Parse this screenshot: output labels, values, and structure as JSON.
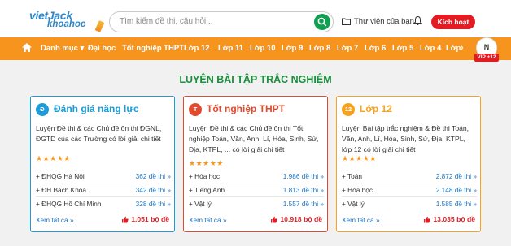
{
  "header": {
    "logo_top": "vietJack",
    "logo_bottom": "khoahoc",
    "search_placeholder": "Tìm kiếm đề thi, câu hỏi...",
    "library_label": "Thư viện của bạn",
    "vip_button": "Kích hoạt VIP"
  },
  "nav": {
    "items": [
      "Danh mục ▾",
      "Đại học",
      "Tốt nghiệp THPT",
      "Lớp 12",
      "Lớp 11",
      "Lớp 10",
      "Lớp 9",
      "Lớp 8",
      "Lớp 7",
      "Lớp 6",
      "Lớp 5",
      "Lớp 4",
      "Lớp"
    ],
    "avatar_letter": "N",
    "vip_badge": "VIP +12",
    "color": "#f7941d"
  },
  "section_title": "LUYỆN BÀI TẬP TRẮC NGHIỆM",
  "cards": [
    {
      "badge": "Đ",
      "title": "Đánh giá năng lực",
      "color": "#1a9cd8",
      "desc": "Luyện Đề thi & các Chủ đề ôn thi ĐGNL, ĐGTD của các Trường có lời giải chi tiết",
      "stars": "★★★★★",
      "rows": [
        {
          "label": "+ ĐHQG Hà Nội",
          "value": "362 đề thi »"
        },
        {
          "label": "+ ĐH Bách Khoa",
          "value": "342 đề thi »"
        },
        {
          "label": "+ ĐHQG Hồ Chí Minh",
          "value": "328 đề thi »"
        }
      ],
      "see_all": "Xem tất cả »",
      "count": "1.051 bộ đề"
    },
    {
      "badge": "T",
      "title": "Tốt nghiệp THPT",
      "color": "#e04a2f",
      "desc": "Luyện Đề thi & các Chủ đề ôn thi Tốt nghiệp Toán, Văn, Anh, Lí, Hóa, Sinh, Sử, Địa, KTPL, ... có lời giải chi tiết",
      "stars": "★★★★★",
      "rows": [
        {
          "label": "+ Hóa học",
          "value": "1.986 đề thi »"
        },
        {
          "label": "+ Tiếng Anh",
          "value": "1.813 đề thi »"
        },
        {
          "label": "+ Vật lý",
          "value": "1.557 đề thi »"
        }
      ],
      "see_all": "Xem tất cả »",
      "count": "10.918 bộ đề"
    },
    {
      "badge": "12",
      "title": "Lớp 12",
      "color": "#f7a21b",
      "desc": "Luyện Bài tập trắc nghiệm & Đề thi Toán, Văn, Anh, Lí, Hóa, Sinh, Sử, Địa, KTPL, lớp 12 có lời giải chi tiết",
      "stars": "★★★★★",
      "rows": [
        {
          "label": "+ Toán",
          "value": "2.872 đề thi »"
        },
        {
          "label": "+ Hóa học",
          "value": "2.148 đề thi »"
        },
        {
          "label": "+ Vật lý",
          "value": "1.585 đề thi »"
        }
      ],
      "see_all": "Xem tất cả »",
      "count": "13.035 bộ đề"
    }
  ]
}
